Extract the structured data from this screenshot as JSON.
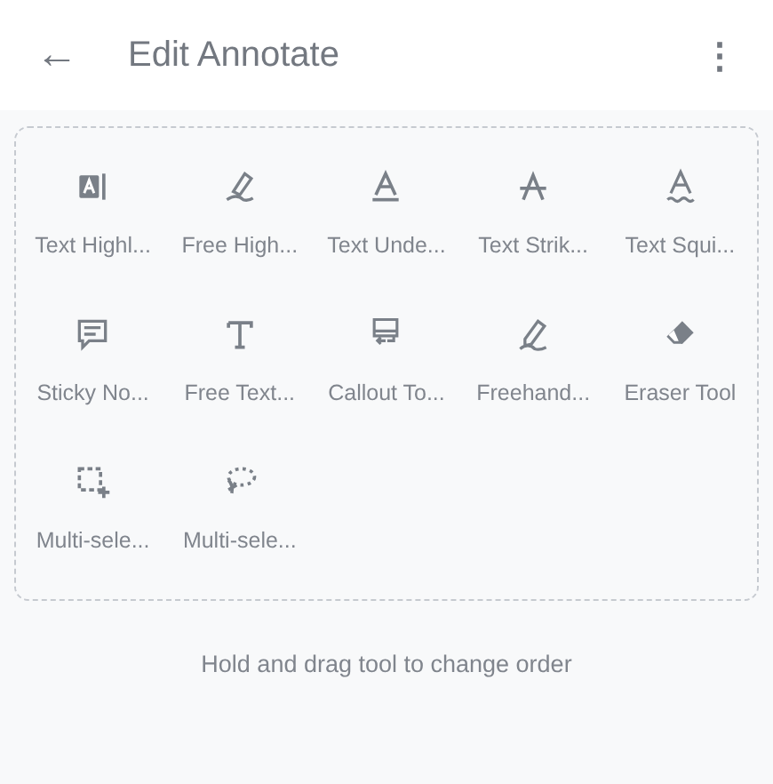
{
  "header": {
    "back": "←",
    "title": "Edit Annotate",
    "menu": "⋮"
  },
  "tools": [
    {
      "label": "Text Highl..."
    },
    {
      "label": "Free High..."
    },
    {
      "label": "Text Unde..."
    },
    {
      "label": "Text Strik..."
    },
    {
      "label": "Text Squi..."
    },
    {
      "label": "Sticky No..."
    },
    {
      "label": "Free Text..."
    },
    {
      "label": "Callout To..."
    },
    {
      "label": "Freehand..."
    },
    {
      "label": "Eraser Tool"
    },
    {
      "label": "Multi-sele..."
    },
    {
      "label": "Multi-sele..."
    }
  ],
  "hint": "Hold and drag tool to change order"
}
